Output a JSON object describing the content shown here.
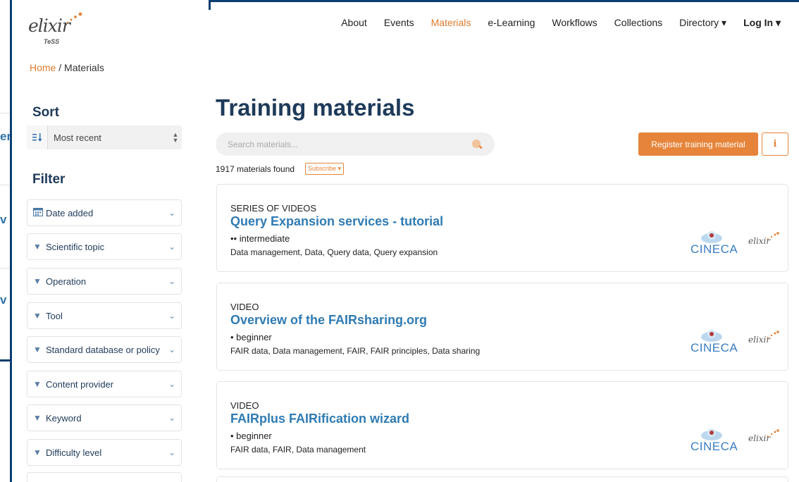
{
  "logo": {
    "wordmark": "elixir",
    "sub": "TeSS"
  },
  "nav": {
    "items": [
      "About",
      "Events",
      "Materials",
      "e-Learning",
      "Workflows",
      "Collections",
      "Directory ▾",
      "Log In ▾"
    ]
  },
  "breadcrumb": {
    "home": "Home",
    "sep": "/",
    "current": "Materials"
  },
  "sidebar": {
    "sort_heading": "Sort",
    "sort_value": "Most recent",
    "filter_heading": "Filter",
    "filters": [
      "Date added",
      "Scientific topic",
      "Operation",
      "Tool",
      "Standard database or policy",
      "Content provider",
      "Keyword",
      "Difficulty level"
    ]
  },
  "main": {
    "title": "Training materials",
    "search_placeholder": "Search materials...",
    "register_label": "Register training material",
    "info_label": "i",
    "count_text": "1917 materials found",
    "subscribe_label": "Subscribe ▾"
  },
  "materials": [
    {
      "type": "SERIES OF VIDEOS",
      "title": "Query Expansion services - tutorial",
      "level": "•• intermediate",
      "topics": "Data management, Data, Query data, Query expansion",
      "provider_logo": "CINECA",
      "provider_logo_2": "elixir"
    },
    {
      "type": "VIDEO",
      "title": "Overview of the FAIRsharing.org",
      "level": "• beginner",
      "topics": "FAIR data, Data management, FAIR, FAIR principles, Data sharing",
      "provider_logo": "CINECA",
      "provider_logo_2": "elixir"
    },
    {
      "type": "VIDEO",
      "title": "FAIRplus FAIRification wizard",
      "level": "• beginner",
      "topics": "FAIR data, FAIR, Data management",
      "provider_logo": "CINECA",
      "provider_logo_2": "elixir"
    }
  ],
  "colors": {
    "accent": "#e5843a",
    "heading": "#1e3a5a",
    "link": "#2f7bb3"
  },
  "icons": [
    "calendar-icon",
    "filter-icon",
    "sort-icon",
    "search-icon",
    "chevron-down-icon",
    "info-icon"
  ]
}
